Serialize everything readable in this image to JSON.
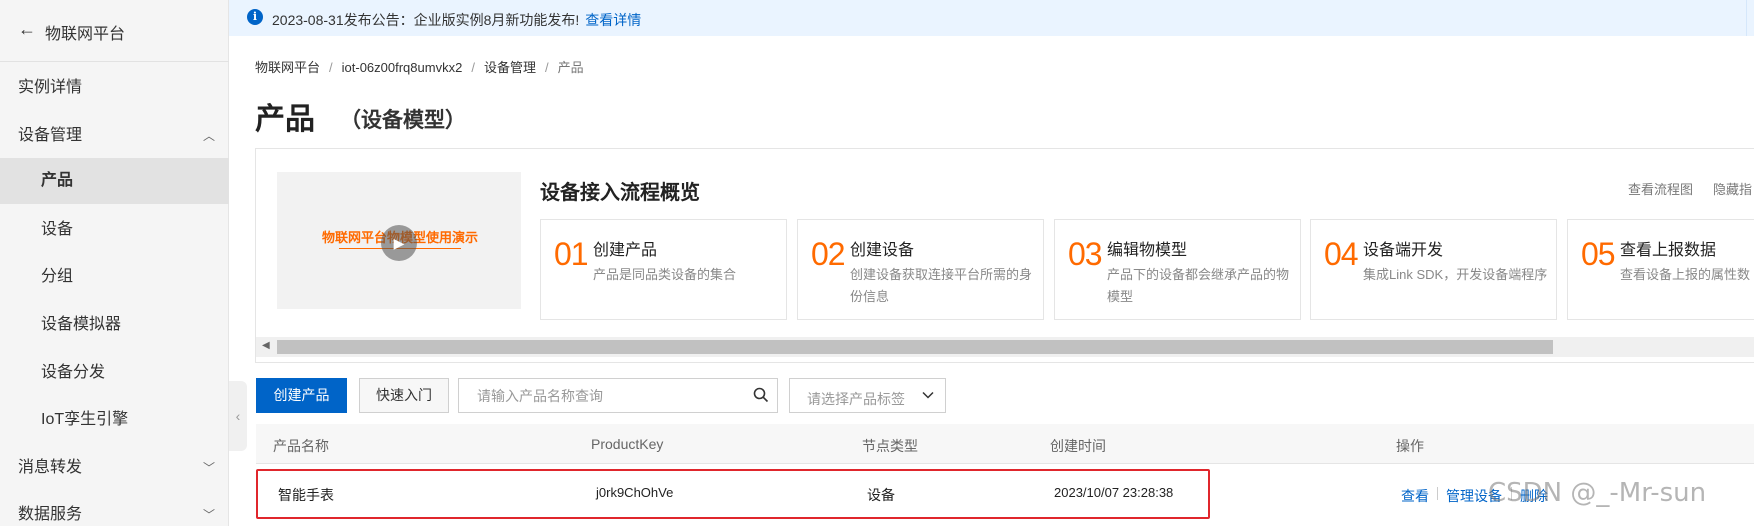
{
  "sidebar": {
    "title": "物联网平台",
    "items": [
      {
        "label": "实例详情"
      },
      {
        "label": "设备管理",
        "chevron": "up"
      },
      {
        "label": "产品",
        "active": true
      },
      {
        "label": "设备"
      },
      {
        "label": "分组"
      },
      {
        "label": "设备模拟器"
      },
      {
        "label": "设备分发"
      },
      {
        "label": "IoT孪生引擎"
      },
      {
        "label": "消息转发",
        "chevron": "down"
      },
      {
        "label": "数据服务",
        "chevron": "down"
      }
    ]
  },
  "notice": {
    "text": "2023-08-31发布公告：企业版实例8月新功能发布!",
    "link": "查看详情"
  },
  "breadcrumb": [
    "物联网平台",
    "iot-06z00frq8umvkx2",
    "设备管理",
    "产品"
  ],
  "page": {
    "title": "产品",
    "subtitle": "（设备模型）"
  },
  "overview": {
    "video_label": "物联网平台物模型使用演示",
    "title": "设备接入流程概览",
    "link_flowchart": "查看流程图",
    "link_hide": "隐藏指",
    "steps": [
      {
        "num": "01",
        "title": "创建产品",
        "desc": "产品是同品类设备的集合"
      },
      {
        "num": "02",
        "title": "创建设备",
        "desc": "创建设备获取连接平台所需的身份信息"
      },
      {
        "num": "03",
        "title": "编辑物模型",
        "desc": "产品下的设备都会继承产品的物模型"
      },
      {
        "num": "04",
        "title": "设备端开发",
        "desc": "集成Link SDK，开发设备端程序"
      },
      {
        "num": "05",
        "title": "查看上报数据",
        "desc": "查看设备上报的属性数"
      }
    ]
  },
  "toolbar": {
    "create_label": "创建产品",
    "quickstart_label": "快速入门",
    "search_placeholder": "请输入产品名称查询",
    "tag_placeholder": "请选择产品标签"
  },
  "table": {
    "columns": [
      "产品名称",
      "ProductKey",
      "节点类型",
      "创建时间",
      "操作"
    ],
    "rows": [
      {
        "name": "智能手表",
        "product_key": "j0rk9ChOhVe",
        "node_type": "设备",
        "created": "2023/10/07 23:28:38",
        "actions": [
          "查看",
          "管理设备",
          "删除"
        ]
      }
    ]
  },
  "watermark": "CSDN @_-Mr-sun",
  "colors": {
    "primary": "#0064c8",
    "accent_orange": "#ff6a00",
    "highlight_red": "#e0262c",
    "notice_bg": "#eaf4ff"
  }
}
